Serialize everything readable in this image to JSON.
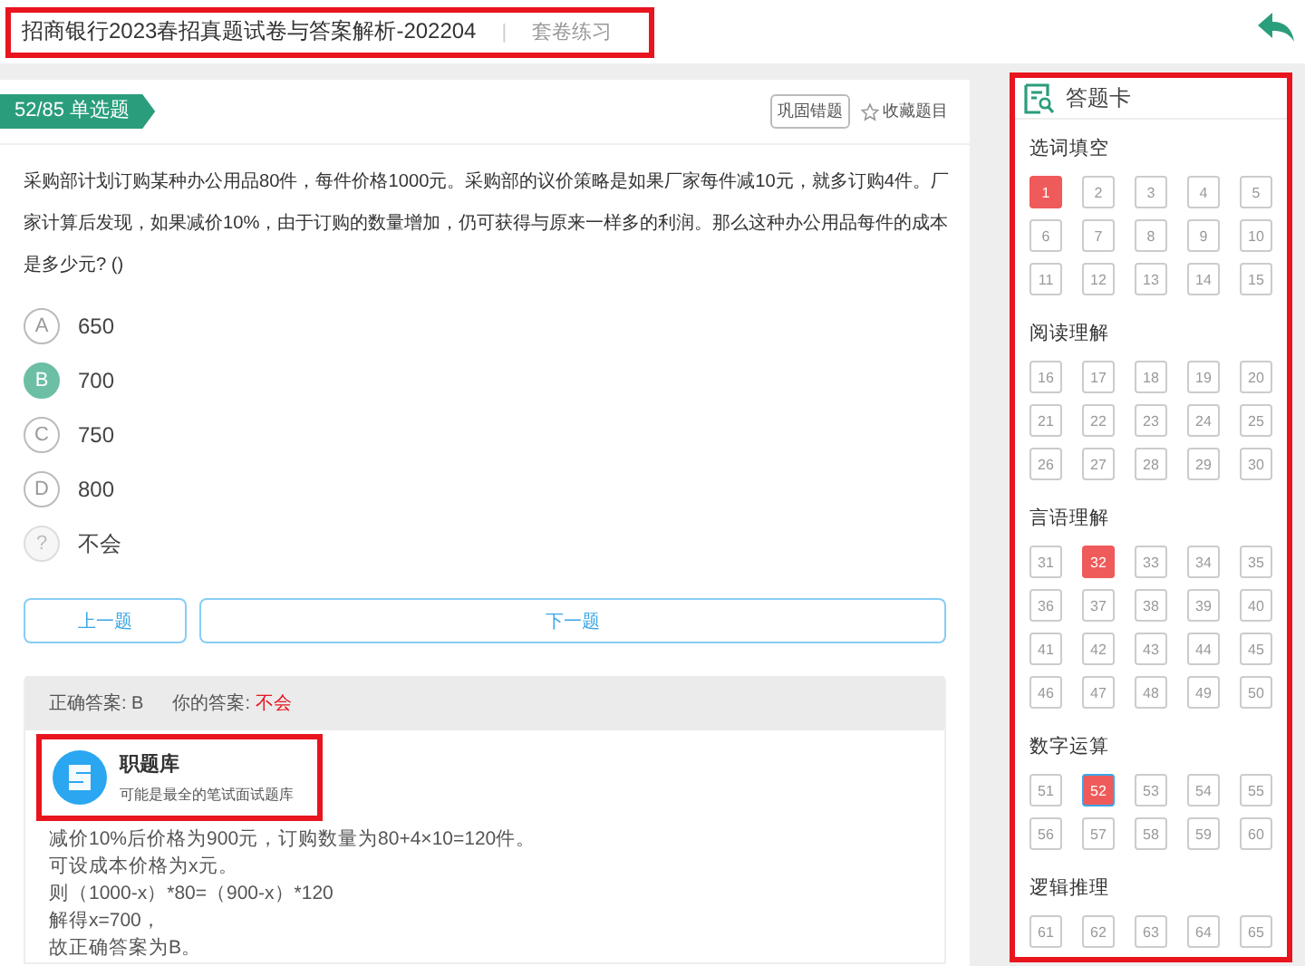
{
  "header": {
    "title": "招商银行2023春招真题试卷与答案解析-202204",
    "separator": "|",
    "subtitle": "套卷练习",
    "highlighted": true
  },
  "question": {
    "tag": "52/85 单选题",
    "actions": [
      {
        "label": "巩固错题",
        "kind": "outlined"
      },
      {
        "label": "收藏题目",
        "kind": "star"
      }
    ],
    "text": "采购部计划订购某种办公用品80件，每件价格1000元。采购部的议价策略是如果厂家每件减10元，就多订购4件。厂家计算后发现，如果减价10%，由于订购的数量增加，仍可获得与原来一样多的利润。那么这种办公用品每件的成本是多少元? ()",
    "options": [
      {
        "kind": "letter",
        "letter": "A",
        "text": "650",
        "selected": false
      },
      {
        "kind": "letter",
        "letter": "B",
        "text": "700",
        "selected": true
      },
      {
        "kind": "letter",
        "letter": "C",
        "text": "750",
        "selected": false
      },
      {
        "kind": "letter",
        "letter": "D",
        "text": "800",
        "selected": false
      },
      {
        "kind": "unknown",
        "letter": "?",
        "text": "不会",
        "selected": false
      }
    ]
  },
  "nav": [
    "上一题",
    "下一题"
  ],
  "answer": {
    "correct_label": "正确答案:",
    "correct": "B",
    "yours_label": "你的答案:",
    "yours": "不会",
    "brand": {
      "name": "职题库",
      "tagline": "可能是最全的笔试面试题库",
      "highlighted": true
    },
    "explanation": [
      "减价10%后价格为900元，订购数量为80+4×10=120件。",
      "可设成本价格为x元。",
      "则（1000-x）*80=（900-x）*120",
      "解得x=700，",
      "故正确答案为B。"
    ]
  },
  "card": {
    "title": "答题卡",
    "highlighted": true,
    "sections": [
      {
        "name": "选词填空",
        "items": [
          {
            "label": "1",
            "wrong": true,
            "current": false
          },
          {
            "label": "2",
            "wrong": false,
            "current": false
          },
          {
            "label": "3",
            "wrong": false,
            "current": false
          },
          {
            "label": "4",
            "wrong": false,
            "current": false
          },
          {
            "label": "5",
            "wrong": false,
            "current": false
          },
          {
            "label": "6",
            "wrong": false,
            "current": false
          },
          {
            "label": "7",
            "wrong": false,
            "current": false
          },
          {
            "label": "8",
            "wrong": false,
            "current": false
          },
          {
            "label": "9",
            "wrong": false,
            "current": false
          },
          {
            "label": "10",
            "wrong": false,
            "current": false
          },
          {
            "label": "11",
            "wrong": false,
            "current": false
          },
          {
            "label": "12",
            "wrong": false,
            "current": false
          },
          {
            "label": "13",
            "wrong": false,
            "current": false
          },
          {
            "label": "14",
            "wrong": false,
            "current": false
          },
          {
            "label": "15",
            "wrong": false,
            "current": false
          }
        ]
      },
      {
        "name": "阅读理解",
        "items": [
          {
            "label": "16",
            "wrong": false,
            "current": false
          },
          {
            "label": "17",
            "wrong": false,
            "current": false
          },
          {
            "label": "18",
            "wrong": false,
            "current": false
          },
          {
            "label": "19",
            "wrong": false,
            "current": false
          },
          {
            "label": "20",
            "wrong": false,
            "current": false
          },
          {
            "label": "21",
            "wrong": false,
            "current": false
          },
          {
            "label": "22",
            "wrong": false,
            "current": false
          },
          {
            "label": "23",
            "wrong": false,
            "current": false
          },
          {
            "label": "24",
            "wrong": false,
            "current": false
          },
          {
            "label": "25",
            "wrong": false,
            "current": false
          },
          {
            "label": "26",
            "wrong": false,
            "current": false
          },
          {
            "label": "27",
            "wrong": false,
            "current": false
          },
          {
            "label": "28",
            "wrong": false,
            "current": false
          },
          {
            "label": "29",
            "wrong": false,
            "current": false
          },
          {
            "label": "30",
            "wrong": false,
            "current": false
          }
        ]
      },
      {
        "name": "言语理解",
        "items": [
          {
            "label": "31",
            "wrong": false,
            "current": false
          },
          {
            "label": "32",
            "wrong": true,
            "current": false
          },
          {
            "label": "33",
            "wrong": false,
            "current": false
          },
          {
            "label": "34",
            "wrong": false,
            "current": false
          },
          {
            "label": "35",
            "wrong": false,
            "current": false
          },
          {
            "label": "36",
            "wrong": false,
            "current": false
          },
          {
            "label": "37",
            "wrong": false,
            "current": false
          },
          {
            "label": "38",
            "wrong": false,
            "current": false
          },
          {
            "label": "39",
            "wrong": false,
            "current": false
          },
          {
            "label": "40",
            "wrong": false,
            "current": false
          },
          {
            "label": "41",
            "wrong": false,
            "current": false
          },
          {
            "label": "42",
            "wrong": false,
            "current": false
          },
          {
            "label": "43",
            "wrong": false,
            "current": false
          },
          {
            "label": "44",
            "wrong": false,
            "current": false
          },
          {
            "label": "45",
            "wrong": false,
            "current": false
          },
          {
            "label": "46",
            "wrong": false,
            "current": false
          },
          {
            "label": "47",
            "wrong": false,
            "current": false
          },
          {
            "label": "48",
            "wrong": false,
            "current": false
          },
          {
            "label": "49",
            "wrong": false,
            "current": false
          },
          {
            "label": "50",
            "wrong": false,
            "current": false
          }
        ]
      },
      {
        "name": "数字运算",
        "items": [
          {
            "label": "51",
            "wrong": false,
            "current": false
          },
          {
            "label": "52",
            "wrong": true,
            "current": true
          },
          {
            "label": "53",
            "wrong": false,
            "current": false
          },
          {
            "label": "54",
            "wrong": false,
            "current": false
          },
          {
            "label": "55",
            "wrong": false,
            "current": false
          },
          {
            "label": "56",
            "wrong": false,
            "current": false
          },
          {
            "label": "57",
            "wrong": false,
            "current": false
          },
          {
            "label": "58",
            "wrong": false,
            "current": false
          },
          {
            "label": "59",
            "wrong": false,
            "current": false
          },
          {
            "label": "60",
            "wrong": false,
            "current": false
          }
        ]
      },
      {
        "name": "逻辑推理",
        "items": [
          {
            "label": "61",
            "wrong": false,
            "current": false
          },
          {
            "label": "62",
            "wrong": false,
            "current": false
          },
          {
            "label": "63",
            "wrong": false,
            "current": false
          },
          {
            "label": "64",
            "wrong": false,
            "current": false
          },
          {
            "label": "65",
            "wrong": false,
            "current": false
          }
        ]
      }
    ]
  }
}
